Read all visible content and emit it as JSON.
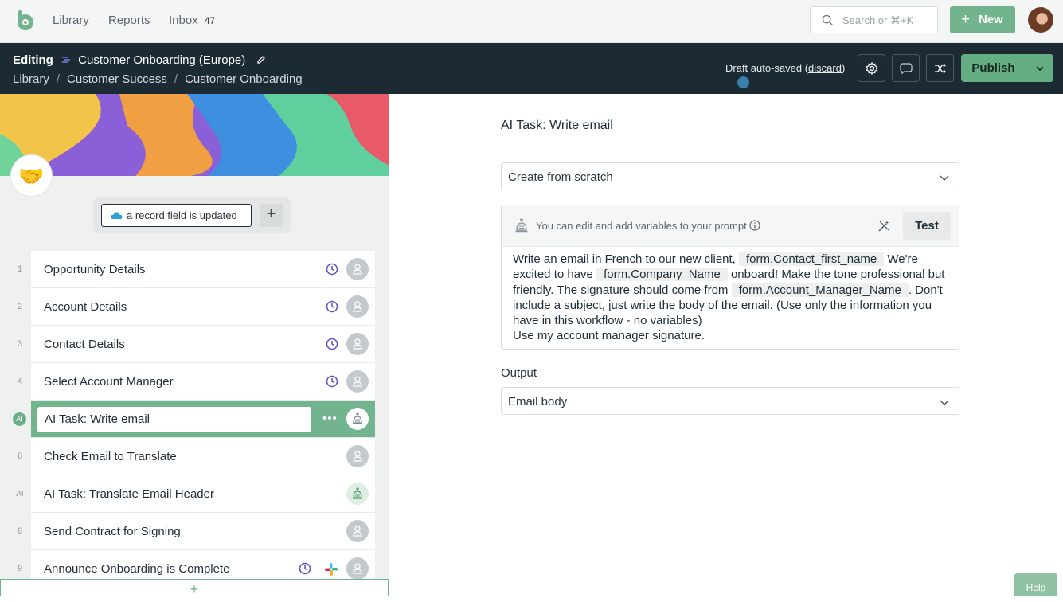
{
  "nav": {
    "library": "Library",
    "reports": "Reports",
    "inbox": "Inbox",
    "inbox_count": "47",
    "search_placeholder": "Search or ⌘+K",
    "new_label": "New"
  },
  "editbar": {
    "mode": "Editing",
    "workflow_name": "Customer Onboarding (Europe)",
    "breadcrumb": [
      "Library",
      "Customer Success",
      "Customer Onboarding"
    ],
    "draft_prefix": "Draft auto-saved (",
    "discard": "discard",
    "draft_suffix": ")",
    "publish": "Publish"
  },
  "trigger": {
    "label": "a record field is updated"
  },
  "steps": [
    {
      "num": "1",
      "title": "Opportunity Details"
    },
    {
      "num": "2",
      "title": "Account Details"
    },
    {
      "num": "3",
      "title": "Contact Details"
    },
    {
      "num": "4",
      "title": "Select Account Manager"
    },
    {
      "num": "AI",
      "title": "AI Task: Write email"
    },
    {
      "num": "6",
      "title": "Check Email to Translate"
    },
    {
      "num": "AI",
      "title": "AI Task: Translate Email Header"
    },
    {
      "num": "8",
      "title": "Send Contract for Signing"
    },
    {
      "num": "9",
      "title": "Announce Onboarding is Complete"
    }
  ],
  "panel": {
    "title": "AI Task: Write email",
    "mode_select": "Create from scratch",
    "prompt_hint": "You can edit and add variables to your prompt",
    "test": "Test",
    "prompt": {
      "t1": "Write an email in French to our new client, ",
      "v1": "form.Contact_first_name",
      "t2": " We're excited to have ",
      "v2": "form.Company_Name",
      "t3": " onboard! Make the tone professional but friendly. The signature should come from ",
      "v3": "form.Account_Manager_Name",
      "t4": ". Don't include a subject, just write the body of the email. (Use only the information you have in this workflow - no variables)",
      "t5": "Use my account manager signature."
    },
    "output_label": "Output",
    "output_select": "Email body"
  },
  "help": "Help",
  "colors": {
    "accent": "#72b48e",
    "header_dark": "#1c2a33",
    "clock": "#5b4fc4"
  }
}
